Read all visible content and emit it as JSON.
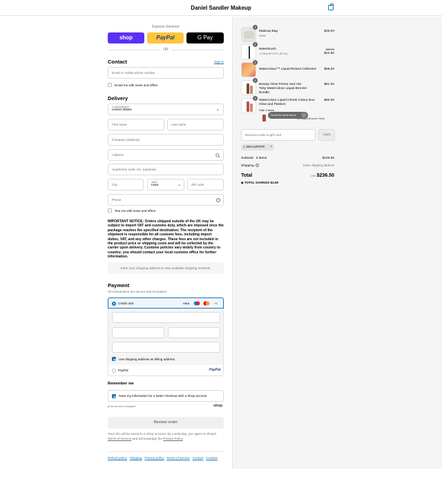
{
  "header": {
    "store_name": "Daniel Sandler Makeup"
  },
  "express": {
    "label": "Express checkout",
    "shop": "shop",
    "paypal": "PayPal",
    "gpay": "G Pay",
    "or": "OR"
  },
  "contact": {
    "heading": "Contact",
    "signin": "Sign in",
    "email_placeholder": "Email or mobile phone number",
    "newsletter": "Email me with news and offers"
  },
  "delivery": {
    "heading": "Delivery",
    "country_label": "Country/Region",
    "country_value": "United States",
    "first_name": "First name",
    "last_name": "Last name",
    "company": "Company (optional)",
    "address": "Address",
    "apartment": "Apartment, suite, etc. (optional)",
    "city": "City",
    "state_label": "State",
    "state_value": "Iowa",
    "zip": "ZIP code",
    "phone": "Phone",
    "text_offers": "Text me with news and offers"
  },
  "notice": "IMPORTANT NOTICE: Orders shipped outside of the UK may be subject to import VAT and customs duty, which are imposed once the package reaches the specified destination. The recipient of the shipment is responsible for all customs fees, including import duties, VAT, and any other charges. These fees are not included in the product price or shipping costs and will be collected by the carrier upon delivery. Customs policies vary widely from country to country; you should contact your local customs office for further information.",
  "shipping_method_hint": "Enter your shipping address to view available shipping methods.",
  "payment": {
    "heading": "Payment",
    "subtitle": "All transactions are secure and encrypted.",
    "credit_card": "Credit card",
    "card_brands": [
      "VISA",
      "+4"
    ],
    "billing_same": "Use shipping address as billing address",
    "paypal": "PayPal",
    "paypal_logo": "PayPal"
  },
  "remember": {
    "heading": "Remember me",
    "save_info": "Save my information for a faster checkout with a Shop account",
    "secure": "Secure and encrypted",
    "shop_logo": "shop"
  },
  "review_button": "Review order",
  "terms": {
    "text1": "Your info will be saved to a Shop account. By continuing, you agree to Shop's",
    "terms_link": "Terms of Service",
    "text2": "and acknowledge the",
    "privacy_link": "Privacy Policy",
    "end": "."
  },
  "footer_links": [
    "Refund policy",
    "Shipping",
    "Privacy policy",
    "Terms of service",
    "Contact",
    "Cookies"
  ],
  "cart": {
    "items": [
      {
        "qty": "1",
        "name": "Makeup Bag",
        "variant": "White",
        "price": "$25.00"
      },
      {
        "qty": "1",
        "name": "Waterbrush",
        "discount": "DEALSPOTR (-$2.50)",
        "old_price": "$25.00",
        "price": "$22.50"
      },
      {
        "qty": "1",
        "name": "Watercolour™ Liquid Riviera Collection",
        "price": "$58.00"
      },
      {
        "qty": "1",
        "name": "Beauty Glow Primer and Hot Totty Watercolour Liquid Bronzer Bundle",
        "price": "$81.00"
      },
      {
        "qty": "1",
        "name": "Watercolour Liquid Cheek Colour Duo Glow and Passion",
        "sub": "Hide 2 items",
        "sub2": "Watercolour Liquid Bronzer Glow",
        "price": "$50.00"
      }
    ],
    "scroll_hint": "Scroll for more items",
    "discount_placeholder": "Discount code or gift card",
    "apply": "Apply",
    "code_tag": "DEALSPOTR",
    "subtotal_label": "Subtotal · 5 items",
    "subtotal_value": "$236.50",
    "shipping_label": "Shipping",
    "shipping_value": "Enter shipping address",
    "total_label": "Total",
    "currency": "USD",
    "total_value": "$236.50",
    "savings_label": "TOTAL SAVINGS",
    "savings_value": "$2.50"
  },
  "colors": {
    "accent": "#1773b0",
    "shop_purple": "#5a31f4",
    "paypal_yellow": "#ffc439"
  }
}
